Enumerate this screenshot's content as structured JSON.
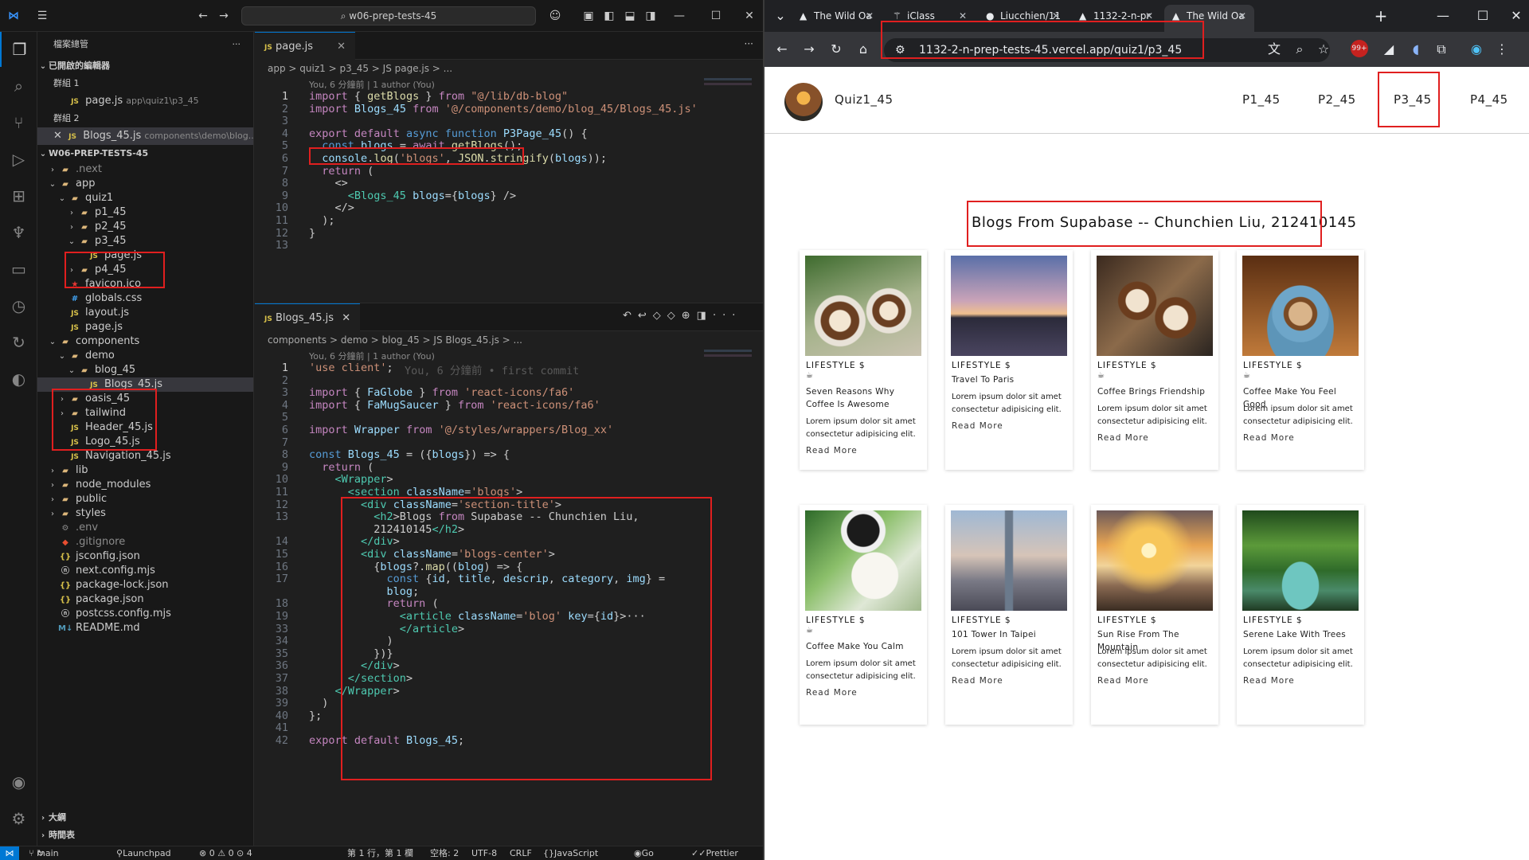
{
  "vscode": {
    "command_center": "w06-prep-tests-45",
    "explorer_title": "檔案總管",
    "open_editors": "已開啟的編輯器",
    "group1": "群組 1",
    "group1_file": "page.js",
    "group1_path": "app\\quiz1\\p3_45",
    "group2": "群組 2",
    "group2_file": "Blogs_45.js",
    "group2_path": "components\\demo\\blog...",
    "project": "W06-PREP-TESTS-45",
    "tree": [
      ".next",
      "app",
      "quiz1",
      "p1_45",
      "p2_45",
      "p3_45",
      "page.js",
      "p4_45",
      "favicon.ico",
      "globals.css",
      "layout.js",
      "page.js",
      "components",
      "demo",
      "blog_45",
      "Blogs_45.js",
      "oasis_45",
      "tailwind",
      "Header_45.js",
      "Logo_45.js",
      "Navigation_45.js",
      "lib",
      "node_modules",
      "public",
      "styles",
      ".env",
      ".gitignore",
      "jsconfig.json",
      "next.config.mjs",
      "package-lock.json",
      "package.json",
      "postcss.config.mjs",
      "README.md"
    ],
    "outline": "大綱",
    "timeline": "時間表",
    "editor1": {
      "tab": "page.js",
      "breadcrumb": "app > quiz1 > p3_45 > JS page.js > ...",
      "lens": "You, 6 分鐘前 | 1 author (You)",
      "lines": [
        "import { getBlogs } from \"@/lib/db-blog\"",
        "import Blogs_45 from '@/components/demo/blog_45/Blogs_45.js'",
        "",
        "export default async function P3Page_45() {",
        "  const blogs = await getBlogs();",
        "  console.log('blogs', JSON.stringify(blogs));",
        "  return (",
        "    <>",
        "      <Blogs_45 blogs={blogs} />",
        "    </>",
        "  );",
        "}",
        ""
      ]
    },
    "editor2": {
      "tab": "Blogs_45.js",
      "breadcrumb": "components > demo > blog_45 > JS Blogs_45.js > ...",
      "lens": "You, 6 分鐘前 | 1 author (You)",
      "ghost": "You, 6 分鐘前 • first commit",
      "line_numbers": [
        "1",
        "2",
        "3",
        "4",
        "5",
        "6",
        "7",
        "8",
        "9",
        "10",
        "11",
        "12",
        "13",
        "",
        "14",
        "15",
        "16",
        "17",
        "",
        "18",
        "19",
        "33",
        "34",
        "35",
        "36",
        "37",
        "38",
        "39",
        "40",
        "41",
        "42"
      ],
      "lines": [
        "'use client';",
        "",
        "import { FaGlobe } from 'react-icons/fa6'",
        "import { FaMugSaucer } from 'react-icons/fa6'",
        "",
        "import Wrapper from '@/styles/wrappers/Blog_xx'",
        "",
        "const Blogs_45 = ({blogs}) => {",
        "  return (",
        "    <Wrapper>",
        "      <section className='blogs'>",
        "        <div className='section-title'>",
        "          <h2>Blogs from Supabase -- Chunchien Liu,",
        "          212410145</h2>",
        "        </div>",
        "        <div className='blogs-center'>",
        "          {blogs?.map((blog) => {",
        "            const {id, title, descrip, category, img} =",
        "            blog;",
        "            return (",
        "              <article className='blog' key={id}>···",
        "              </article>",
        "            )",
        "          })}",
        "        </div>",
        "      </section>",
        "    </Wrapper>",
        "  )",
        "};",
        "",
        "export default Blogs_45;"
      ]
    },
    "status": {
      "branch": "main",
      "launchpad": "Launchpad",
      "problems": "⊗ 0 ⚠ 0 ⊙ 4",
      "position": "第 1 行，第 1 欄",
      "spaces": "空格: 2",
      "encoding": "UTF-8",
      "eol": "CRLF",
      "language": "JavaScript",
      "golive": "Go Live",
      "prettier": "Prettier"
    }
  },
  "browser": {
    "tabs": [
      "The Wild Oa",
      "iClass",
      "Liucchien/11",
      "1132-2-n-pr",
      "The Wild Oa"
    ],
    "url": "1132-2-n-prep-tests-45.vercel.app/quiz1/p3_45",
    "badge": "99+",
    "site": {
      "brand": "Quiz1_45",
      "nav": [
        "P1_45",
        "P2_45",
        "P3_45",
        "P4_45"
      ],
      "section_title": "Blogs From Supabase -- Chunchien Liu, 212410145",
      "cards": [
        {
          "category": "LIFESTYLE $",
          "title": "Seven Reasons Why Coffee Is Awesome",
          "desc": "Lorem ipsum dolor sit amet consectetur adipisicing elit.",
          "more": "Read More",
          "mug": true,
          "image": "coffee-cups"
        },
        {
          "category": "LIFESTYLE $",
          "title": "Travel To Paris",
          "desc": "Lorem ipsum dolor sit amet consectetur adipisicing elit.",
          "more": "Read More",
          "mug": false,
          "image": "paris-bridge"
        },
        {
          "category": "LIFESTYLE $",
          "title": "Coffee Brings Friendship",
          "desc": "Lorem ipsum dolor sit amet consectetur adipisicing elit.",
          "more": "Read More",
          "mug": true,
          "image": "coffee-toast"
        },
        {
          "category": "LIFESTYLE $",
          "title": "Coffee Make You Feel Good",
          "desc": "Lorem ipsum dolor sit amet consectetur adipisicing elit.",
          "more": "Read More",
          "mug": true,
          "image": "blue-cup"
        },
        {
          "category": "LIFESTYLE $",
          "title": "Coffee Make You Calm",
          "desc": "Lorem ipsum dolor sit amet consectetur adipisicing elit.",
          "more": "Read More",
          "mug": true,
          "image": "coffee-plant"
        },
        {
          "category": "LIFESTYLE $",
          "title": "101 Tower In Taipei",
          "desc": "Lorem ipsum dolor sit amet consectetur adipisicing elit.",
          "more": "Read More",
          "mug": false,
          "image": "taipei-101"
        },
        {
          "category": "LIFESTYLE $",
          "title": "Sun Rise From The Mountain",
          "desc": "Lorem ipsum dolor sit amet consectetur adipisicing elit.",
          "more": "Read More",
          "mug": false,
          "image": "sunrise"
        },
        {
          "category": "LIFESTYLE $",
          "title": "Serene Lake With Trees",
          "desc": "Lorem ipsum dolor sit amet consectetur adipisicing elit.",
          "more": "Read More",
          "mug": false,
          "image": "lake"
        }
      ]
    }
  },
  "colors": {
    "accent": "#0078d4",
    "highlight": "#e01f1f"
  }
}
